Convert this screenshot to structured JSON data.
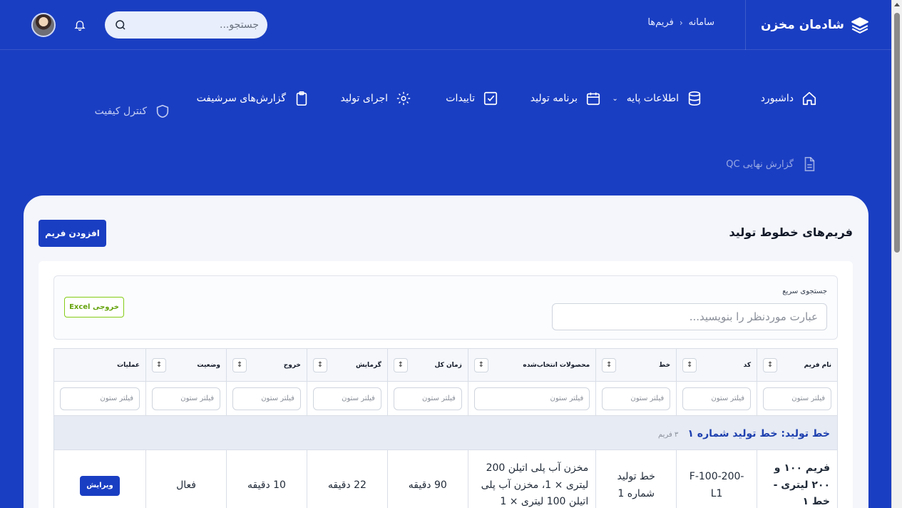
{
  "header": {
    "brand": "شادمان مخزن",
    "breadcrumb": [
      "سامانه",
      "فریم‌ها"
    ],
    "search_placeholder": "جستجو..."
  },
  "nav": {
    "items": [
      {
        "label": "داشبورد",
        "icon": "home-icon"
      },
      {
        "label": "اطلاعات پایه",
        "icon": "database-icon",
        "has_dropdown": true
      },
      {
        "label": "برنامه تولید",
        "icon": "calendar-icon"
      },
      {
        "label": "تاییدات",
        "icon": "checkbox-icon"
      },
      {
        "label": "اجرای تولید",
        "icon": "gear-icon"
      },
      {
        "label": "گزارش‌های سرشیفت",
        "icon": "clipboard-icon"
      },
      {
        "label": "کنترل کیفیت",
        "icon": "shield-icon"
      },
      {
        "label": "گزارش نهایی QC",
        "icon": "document-icon"
      }
    ]
  },
  "page": {
    "title": "فریم‌های خطوط تولید",
    "add_button": "افزودن فریم"
  },
  "filters": {
    "quick_search_label": "جستجوی سریع",
    "quick_search_placeholder": "عبارت موردنظر را بنویسید...",
    "excel_button": "خروجی Excel",
    "column_filter_placeholder": "فیلتر ستون"
  },
  "table": {
    "columns": [
      "نام فریم",
      "کد",
      "خط",
      "محصولات انتخاب‌شده",
      "زمان کل",
      "گرمایش",
      "خروج",
      "وضعیت",
      "عملیات"
    ],
    "group": {
      "title": "خط تولید: خط تولید شماره ۱",
      "count": "۳ فریم"
    },
    "rows": [
      {
        "name": "فریم ۱۰۰ و ۲۰۰ لیتری - خط ۱",
        "code": "F-100-200-L1",
        "line": "خط تولید شماره 1",
        "products": "مخزن آب پلی اتیلن 200 لیتری × 1، مخزن آب پلی اتیلن 100 لیتری × 1",
        "total_time": "90 دقیقه",
        "heating": "22 دقیقه",
        "exit": "10 دقیقه",
        "status": "فعال",
        "action": "ویرایش"
      }
    ]
  },
  "colors": {
    "primary": "#1a3ec2",
    "excel": "#84cc16",
    "group_title": "#1e40af"
  }
}
